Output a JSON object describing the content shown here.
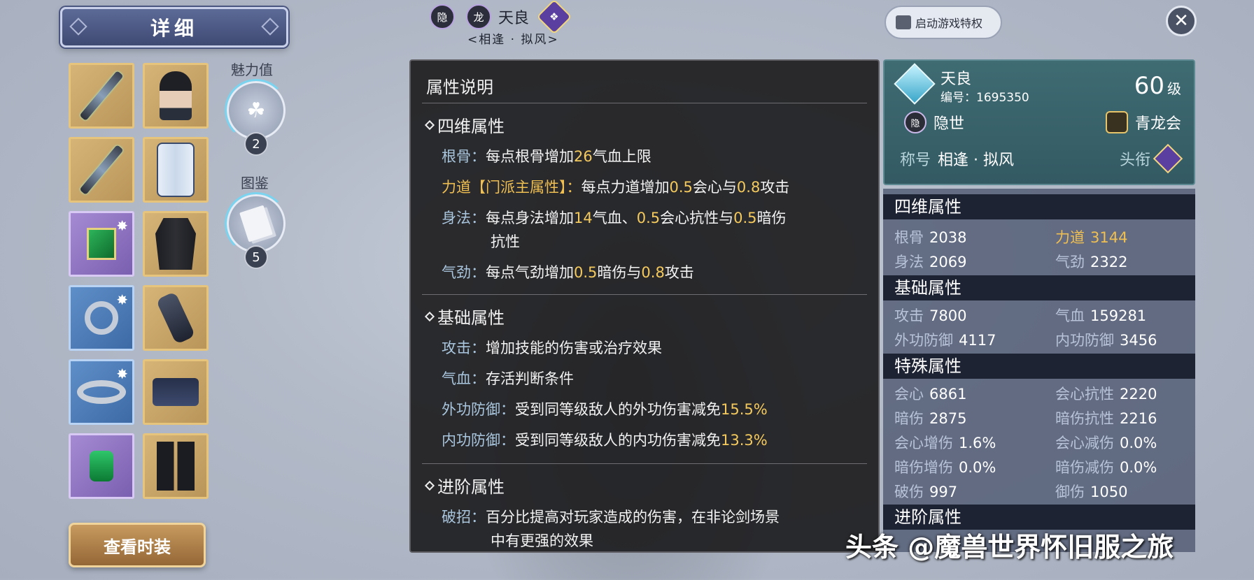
{
  "header": {
    "title": "详细"
  },
  "equipment": {
    "left": [
      {
        "name": "weapon",
        "rarity": "gold"
      },
      {
        "name": "sub-weapon",
        "rarity": "gold"
      },
      {
        "name": "jade-pendant",
        "rarity": "purple",
        "spark": true
      },
      {
        "name": "ring",
        "rarity": "blue",
        "spark": true
      },
      {
        "name": "bracelet",
        "rarity": "blue",
        "spark": true
      },
      {
        "name": "green-pendant",
        "rarity": "purple"
      }
    ],
    "right": [
      {
        "name": "head",
        "rarity": "gold"
      },
      {
        "name": "chest",
        "rarity": "gold"
      },
      {
        "name": "robe",
        "rarity": "gold"
      },
      {
        "name": "glove",
        "rarity": "gold"
      },
      {
        "name": "belt",
        "rarity": "gold"
      },
      {
        "name": "boots",
        "rarity": "gold"
      }
    ]
  },
  "charm": {
    "label": "魅力值",
    "count": "2",
    "icon": "clover-icon"
  },
  "codex": {
    "label": "图鉴",
    "count": "5",
    "icon": "book-icon"
  },
  "fashion_button": "查看时装",
  "top": {
    "hidden_badge": "隐",
    "dragon_badge": "龙",
    "name": "天良",
    "title": "<相逢 · 拟风>"
  },
  "privilege_button": "启动游戏特权",
  "close_icon": "✕",
  "desc": {
    "title": "属性说明",
    "sections": {
      "four": {
        "title": "四维属性",
        "rows": [
          {
            "key": "根骨：",
            "pre": "每点根骨增加",
            "v1": "26",
            "mid": "气血上限",
            "v2": "",
            "mid2": "",
            "v3": "",
            "post": ""
          },
          {
            "key": "力道【门派主属性】：",
            "pre": "每点力道增加",
            "v1": "0.5",
            "mid": "会心与",
            "v2": "0.8",
            "mid2": "攻击",
            "v3": "",
            "post": ""
          },
          {
            "key": "身法：",
            "pre": "每点身法增加",
            "v1": "14",
            "mid": "气血、",
            "v2": "0.5",
            "mid2": "会心抗性与",
            "v3": "0.5",
            "post": "暗伤"
          },
          {
            "cont": "抗性"
          },
          {
            "key": "气劲：",
            "pre": "每点气劲增加",
            "v1": "0.5",
            "mid": "暗伤与",
            "v2": "0.8",
            "mid2": "攻击",
            "v3": "",
            "post": ""
          }
        ]
      },
      "basic": {
        "title": "基础属性",
        "rows": [
          {
            "key": "攻击：",
            "text": "增加技能的伤害或治疗效果",
            "val": ""
          },
          {
            "key": "气血：",
            "text": "存活判断条件",
            "val": ""
          },
          {
            "key": "外功防御：",
            "text": "受到同等级敌人的外功伤害减免",
            "val": "15.5%"
          },
          {
            "key": "内功防御：",
            "text": "受到同等级敌人的内功伤害减免",
            "val": "13.3%"
          }
        ]
      },
      "advanced": {
        "title": "进阶属性",
        "rows": [
          {
            "key": "破招：",
            "text": "百分比提高对玩家造成的伤害，在非论剑场景"
          },
          {
            "text": "中有更强的效果"
          }
        ]
      }
    }
  },
  "character": {
    "name": "天良",
    "id": "编号：1695350",
    "level": "60",
    "level_unit": "级",
    "school_badge": "隐",
    "school": "隐世",
    "guild": "青龙会",
    "title_label": "称号",
    "title_value": "相逢 · 拟风",
    "rank_label": "头衔"
  },
  "stats": {
    "four": {
      "title": "四维属性",
      "items": [
        {
          "k": "根骨",
          "v": "2038",
          "gold": false
        },
        {
          "k": "力道",
          "v": "3144",
          "gold": true
        },
        {
          "k": "身法",
          "v": "2069",
          "gold": false
        },
        {
          "k": "气劲",
          "v": "2322",
          "gold": false
        }
      ]
    },
    "basic": {
      "title": "基础属性",
      "items": [
        {
          "k": "攻击",
          "v": "7800"
        },
        {
          "k": "气血",
          "v": "159281"
        },
        {
          "k": "外功防御",
          "v": "4117"
        },
        {
          "k": "内功防御",
          "v": "3456"
        }
      ]
    },
    "special": {
      "title": "特殊属性",
      "items": [
        {
          "k": "会心",
          "v": "6861"
        },
        {
          "k": "会心抗性",
          "v": "2220"
        },
        {
          "k": "暗伤",
          "v": "2875"
        },
        {
          "k": "暗伤抗性",
          "v": "2216"
        },
        {
          "k": "会心增伤",
          "v": "1.6%"
        },
        {
          "k": "会心减伤",
          "v": "0.0%"
        },
        {
          "k": "暗伤增伤",
          "v": "0.0%"
        },
        {
          "k": "暗伤减伤",
          "v": "0.0%"
        },
        {
          "k": "破伤",
          "v": "997"
        },
        {
          "k": "御伤",
          "v": "1050"
        }
      ]
    },
    "advanced": {
      "title": "进阶属性"
    }
  },
  "watermark": "头条 @魔兽世界怀旧服之旅"
}
